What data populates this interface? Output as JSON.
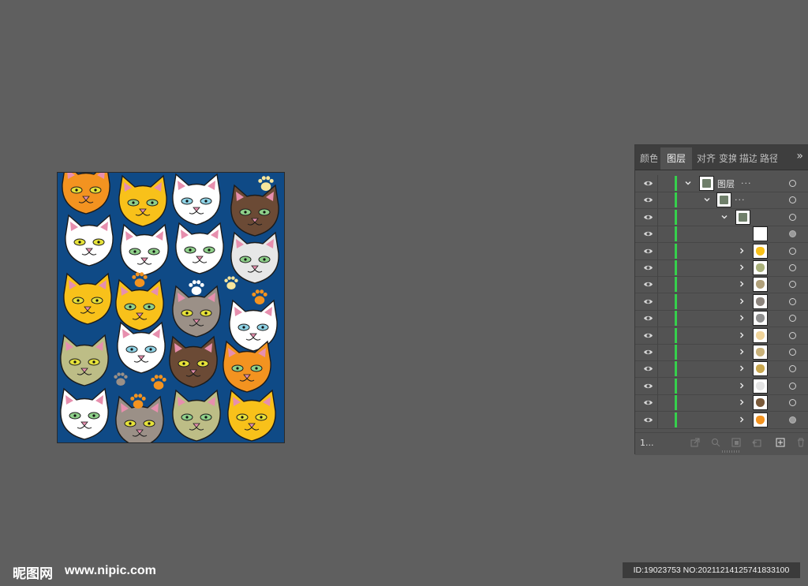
{
  "artboard": {
    "background": "#0f4a86",
    "cat_colors": [
      "#f39320",
      "#f8c11a",
      "#ffffff",
      "#6b4a35",
      "#bdbd86",
      "#9b9087",
      "#e7e7e7"
    ],
    "paw_colors": [
      "#f39320",
      "#ffffff",
      "#f8e69c",
      "#9b9087"
    ]
  },
  "panel": {
    "tabs": [
      {
        "label": "颜色",
        "active": false
      },
      {
        "label": "图层",
        "active": true
      },
      {
        "label": "对齐",
        "active": false
      },
      {
        "label": "变换",
        "active": false
      },
      {
        "label": "描边",
        "active": false
      },
      {
        "label": "路径",
        "active": false
      }
    ],
    "expand_icon": "»",
    "layers": [
      {
        "name": "图层",
        "suffix": "...",
        "depth": 0,
        "expanded": true,
        "type": "layer"
      },
      {
        "name": "",
        "suffix": "...",
        "depth": 1,
        "expanded": true,
        "type": "group"
      },
      {
        "name": "",
        "suffix": "",
        "depth": 2,
        "expanded": true,
        "type": "group"
      },
      {
        "name": "",
        "suffix": "",
        "depth": 3,
        "expanded": false,
        "type": "blank",
        "selected": true
      },
      {
        "name": "",
        "suffix": "",
        "depth": 3,
        "expanded": false,
        "type": "item",
        "thumb_color": "#f8c11a"
      },
      {
        "name": "",
        "suffix": "",
        "depth": 3,
        "expanded": false,
        "type": "item",
        "thumb_color": "#a9b07a"
      },
      {
        "name": "",
        "suffix": "",
        "depth": 3,
        "expanded": false,
        "type": "item",
        "thumb_color": "#b0a07a"
      },
      {
        "name": "",
        "suffix": "",
        "depth": 3,
        "expanded": false,
        "type": "item",
        "thumb_color": "#8d857e"
      },
      {
        "name": "",
        "suffix": "",
        "depth": 3,
        "expanded": false,
        "type": "item",
        "thumb_color": "#8f8f8f"
      },
      {
        "name": "",
        "suffix": "",
        "depth": 3,
        "expanded": false,
        "type": "item",
        "thumb_color": "#f0d49a"
      },
      {
        "name": "",
        "suffix": "",
        "depth": 3,
        "expanded": false,
        "type": "item",
        "thumb_color": "#c9b27a"
      },
      {
        "name": "",
        "suffix": "",
        "depth": 3,
        "expanded": false,
        "type": "item",
        "thumb_color": "#c9a74f"
      },
      {
        "name": "",
        "suffix": "",
        "depth": 3,
        "expanded": false,
        "type": "item",
        "thumb_color": "#e4e4e4"
      },
      {
        "name": "",
        "suffix": "",
        "depth": 3,
        "expanded": false,
        "type": "item",
        "thumb_color": "#7a5a3a"
      },
      {
        "name": "",
        "suffix": "",
        "depth": 3,
        "expanded": false,
        "type": "item",
        "thumb_color": "#f39320",
        "selected": true
      }
    ],
    "footer_count": "1...",
    "footer_icons": [
      "export-icon",
      "locate-object-icon",
      "make-clip-mask-icon",
      "new-sublayer-icon",
      "new-layer-icon",
      "delete-icon"
    ],
    "accent_color": "#36d04c"
  },
  "watermark": {
    "logo": "昵图网",
    "url": "www.nipic.com",
    "id_text": "ID:19023753 NO:20211214125741833100"
  }
}
